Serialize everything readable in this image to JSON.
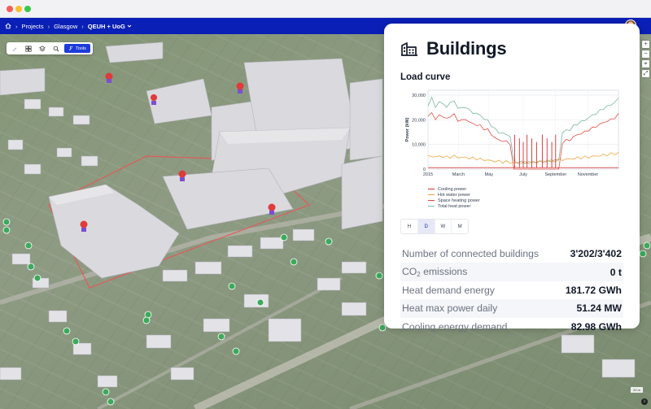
{
  "breadcrumb": {
    "items": [
      "Projects",
      "Glasgow",
      "QEUH + UoG"
    ],
    "separator": "›"
  },
  "toolbar": {
    "tools_label": "Tools"
  },
  "map": {
    "scale_text": "20 m",
    "info_glyph": "i"
  },
  "panel": {
    "title": "Buildings",
    "section_title": "Load curve",
    "resolution_tabs": [
      "H",
      "D",
      "W",
      "M"
    ],
    "active_tab": "D",
    "stats": [
      {
        "label_main": "Number of connected buildings",
        "label_sub": "",
        "label_rest": "",
        "value": "3'202/3'402"
      },
      {
        "label_main": "CO",
        "label_sub": "2",
        "label_rest": " emissions",
        "value": "0 t"
      },
      {
        "label_main": "Heat demand energy",
        "label_sub": "",
        "label_rest": "",
        "value": "181.72 GWh"
      },
      {
        "label_main": "Heat max power daily",
        "label_sub": "",
        "label_rest": "",
        "value": "51.24 MW"
      },
      {
        "label_main": "Cooling energy demand",
        "label_sub": "",
        "label_rest": "",
        "value": "82.98 GWh"
      }
    ]
  },
  "colors": {
    "nav": "#0a1fb5",
    "accent": "#1d3bd9",
    "cooling": "#e0453d",
    "hot_water": "#f0a035",
    "space_heating": "#e0453d",
    "total_heat": "#7fb9a7"
  },
  "chart_data": {
    "type": "line",
    "ylabel": "Power (kW)",
    "xlabel": "",
    "x": [
      "2015",
      "March",
      "May",
      "July",
      "September",
      "November"
    ],
    "yticks": [
      "0",
      "10,000",
      "20,000",
      "30,000"
    ],
    "ylim": [
      0,
      32000
    ],
    "grid": true,
    "legend_position": "bottom",
    "series": [
      {
        "name": "Cooling power",
        "color": "#d32f2f",
        "values": [
          600,
          600,
          600,
          600,
          600,
          600,
          600,
          600,
          600,
          600,
          600,
          600,
          600,
          600,
          600,
          600,
          600,
          600,
          600,
          600,
          600,
          600,
          600,
          600,
          600,
          600,
          600,
          600,
          600,
          600,
          600,
          600,
          600,
          600,
          600,
          600,
          600,
          600,
          600,
          600,
          600,
          600,
          600,
          600,
          600,
          600,
          600,
          600,
          600,
          600,
          600,
          600
        ]
      },
      {
        "name": "Hot water power",
        "color": "#f0a035",
        "values": [
          5000,
          5300,
          4900,
          5200,
          5100,
          4800,
          5000,
          5200,
          4900,
          4700,
          4800,
          4500,
          4400,
          4300,
          4000,
          3800,
          3600,
          3400,
          3200,
          3100,
          3000,
          2900,
          2800,
          2700,
          2600,
          2600,
          2700,
          2800,
          2700,
          2900,
          3000,
          3200,
          3100,
          3300,
          3500,
          3700,
          3900,
          4000,
          4200,
          4300,
          4500,
          4700,
          4800,
          4900,
          5100,
          5300,
          5500,
          5700,
          5900,
          6100,
          6300,
          6500
        ]
      },
      {
        "name": "Space heating power",
        "color": "#e0453d",
        "values": [
          21000,
          23500,
          19500,
          22500,
          21000,
          20500,
          21500,
          22000,
          20000,
          19500,
          20500,
          19000,
          18500,
          18000,
          17500,
          16500,
          15800,
          14200,
          12500,
          11800,
          11500,
          11000,
          10500,
          0,
          0,
          0,
          0,
          0,
          0,
          0,
          0,
          0,
          0,
          0,
          0,
          0,
          11000,
          11500,
          12000,
          13000,
          14000,
          14500,
          15000,
          16000,
          16500,
          17500,
          18000,
          19000,
          19500,
          20000,
          21000,
          22000
        ]
      },
      {
        "name": "Total heat power",
        "color": "#7fb9a7",
        "values": [
          25500,
          29500,
          24500,
          28000,
          26000,
          25500,
          27000,
          27500,
          25000,
          24500,
          25500,
          23800,
          23000,
          22500,
          21800,
          20500,
          19500,
          17800,
          16000,
          15000,
          14500,
          14000,
          13500,
          3000,
          2800,
          2700,
          2700,
          2800,
          2700,
          2900,
          3000,
          3200,
          3100,
          3300,
          3500,
          3700,
          15000,
          15500,
          16200,
          17300,
          18500,
          19200,
          19800,
          21000,
          21600,
          22800,
          23500,
          24700,
          25400,
          26100,
          27300,
          28500
        ]
      }
    ],
    "spikes": {
      "series": "Cooling power",
      "note": "recurring drops of heating to ~0 during summer"
    }
  }
}
